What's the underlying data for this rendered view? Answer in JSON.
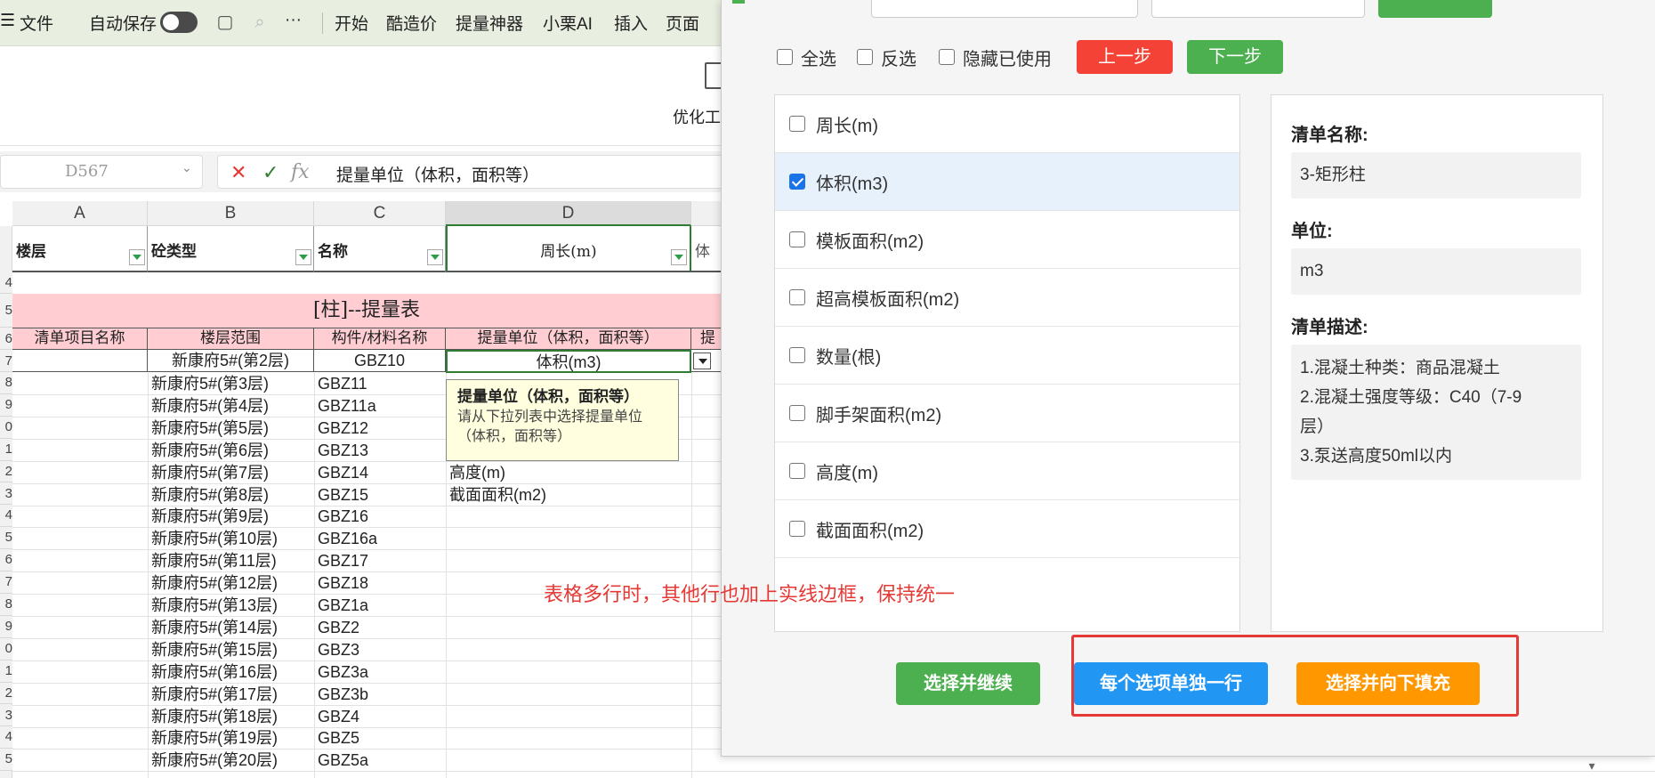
{
  "menubar": {
    "file_label": "文件",
    "autosave_label": "自动保存",
    "more_label": "···",
    "tabs": [
      "开始",
      "酷造价",
      "提量神器",
      "小栗AI",
      "插入",
      "页面"
    ]
  },
  "ribbon": {
    "optimize_label": "优化工"
  },
  "formula_bar": {
    "cell_ref": "D567",
    "formula": "提量单位（体积，面积等）"
  },
  "sheet": {
    "columns": [
      "A",
      "B",
      "C",
      "D"
    ],
    "header_labels": [
      "楼层",
      "砼类型",
      "名称",
      "周长(m)",
      "体"
    ],
    "table_title": "[柱]--提量表",
    "table_headers": [
      "清单项目名称",
      "楼层范围",
      "构件/材料名称",
      "提量单位（体积，面积等）",
      "提"
    ],
    "row_numbers": [
      "4",
      "5",
      "6",
      "7",
      "8",
      "9",
      "0",
      "1",
      "2",
      "3",
      "4",
      "5",
      "6",
      "7",
      "8",
      "9",
      "0",
      "1",
      "2",
      "3",
      "4",
      "5"
    ],
    "first_row": {
      "range": "新康府5#(第2层)",
      "name": "GBZ10",
      "unit": "体积(m3)"
    },
    "rows": [
      {
        "range": "新康府5#(第3层)",
        "name": "GBZ11",
        "unit": ""
      },
      {
        "range": "新康府5#(第4层)",
        "name": "GBZ11a",
        "unit": ""
      },
      {
        "range": "新康府5#(第5层)",
        "name": "GBZ12",
        "unit": ""
      },
      {
        "range": "新康府5#(第6层)",
        "name": "GBZ13",
        "unit": ""
      },
      {
        "range": "新康府5#(第7层)",
        "name": "GBZ14",
        "unit": "高度(m)"
      },
      {
        "range": "新康府5#(第8层)",
        "name": "GBZ15",
        "unit": "截面面积(m2)"
      },
      {
        "range": "新康府5#(第9层)",
        "name": "GBZ16",
        "unit": ""
      },
      {
        "range": "新康府5#(第10层)",
        "name": "GBZ16a",
        "unit": ""
      },
      {
        "range": "新康府5#(第11层)",
        "name": "GBZ17",
        "unit": ""
      },
      {
        "range": "新康府5#(第12层)",
        "name": "GBZ18",
        "unit": ""
      },
      {
        "range": "新康府5#(第13层)",
        "name": "GBZ1a",
        "unit": ""
      },
      {
        "range": "新康府5#(第14层)",
        "name": "GBZ2",
        "unit": ""
      },
      {
        "range": "新康府5#(第15层)",
        "name": "GBZ3",
        "unit": ""
      },
      {
        "range": "新康府5#(第16层)",
        "name": "GBZ3a",
        "unit": ""
      },
      {
        "range": "新康府5#(第17层)",
        "name": "GBZ3b",
        "unit": ""
      },
      {
        "range": "新康府5#(第18层)",
        "name": "GBZ4",
        "unit": ""
      },
      {
        "range": "新康府5#(第19层)",
        "name": "GBZ5",
        "unit": ""
      },
      {
        "range": "新康府5#(第20层)",
        "name": "GBZ5a",
        "unit": ""
      }
    ],
    "tooltip": {
      "title": "提量单位（体积，面积等）",
      "body": "请从下拉列表中选择提量单位（体积，面积等）"
    }
  },
  "dialog": {
    "select_all": "全选",
    "invert": "反选",
    "hide_used": "隐藏已使用",
    "prev_label": "上一步",
    "next_label": "下一步",
    "options": [
      {
        "label": "周长(m)",
        "checked": false
      },
      {
        "label": "体积(m3)",
        "checked": true
      },
      {
        "label": "模板面积(m2)",
        "checked": false
      },
      {
        "label": "超高模板面积(m2)",
        "checked": false
      },
      {
        "label": "数量(根)",
        "checked": false
      },
      {
        "label": "脚手架面积(m2)",
        "checked": false
      },
      {
        "label": "高度(m)",
        "checked": false
      },
      {
        "label": "截面面积(m2)",
        "checked": false
      }
    ],
    "info": {
      "name_label": "清单名称:",
      "name_value": "3-矩形柱",
      "unit_label": "单位:",
      "unit_value": "m3",
      "desc_label": "清单描述:",
      "desc_lines": [
        "1.混凝土种类：商品混凝土",
        "2.混凝土强度等级：C40（7-9",
        "层）",
        "3.泵送高度50ml以内"
      ]
    },
    "annotation": "表格多行时，其他行也加上实线边框，保持统一",
    "btn_continue": "选择并继续",
    "btn_each_row": "每个选项单独一行",
    "btn_fill_down": "选择并向下填充"
  },
  "colors": {
    "green": "#4caf50",
    "red": "#f44336",
    "blue": "#2196f3",
    "orange": "#ff9800",
    "title_bg": "#ffcdd2",
    "annotation": "#e53935"
  }
}
